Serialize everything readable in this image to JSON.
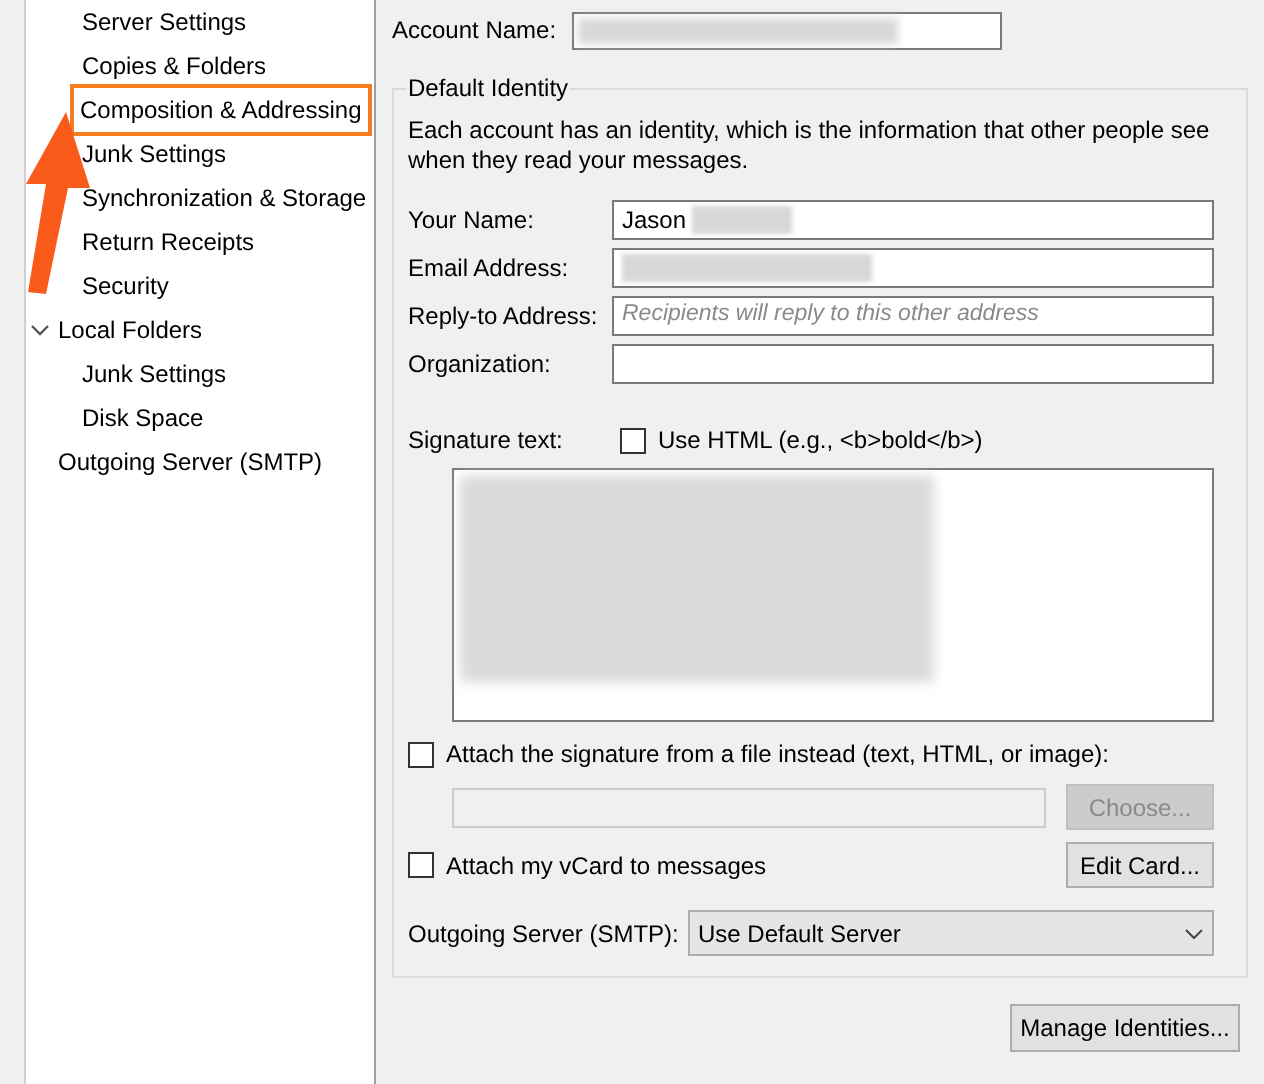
{
  "sidebar": {
    "account_pages": [
      {
        "label": "Server Settings",
        "selected": false
      },
      {
        "label": "Copies & Folders",
        "selected": false
      },
      {
        "label": "Composition & Addressing",
        "selected": true
      },
      {
        "label": "Junk Settings",
        "selected": false
      },
      {
        "label": "Synchronization & Storage",
        "selected": false
      },
      {
        "label": "Return Receipts",
        "selected": false
      },
      {
        "label": "Security",
        "selected": false
      }
    ],
    "items": [
      {
        "label": "Local Folders",
        "selected": false,
        "expanded": true,
        "children": [
          {
            "label": "Junk Settings",
            "selected": false
          },
          {
            "label": "Disk Space",
            "selected": false
          }
        ]
      },
      {
        "label": "Outgoing Server (SMTP)",
        "selected": false
      }
    ]
  },
  "account_name": {
    "label": "Account Name:"
  },
  "default_identity": {
    "title": "Default Identity",
    "description": "Each account has an identity, which is the information that other people see when they read your messages.",
    "fields": [
      {
        "label": "Your Name:",
        "value": "Jason",
        "redacted": true
      },
      {
        "label": "Email Address:",
        "redacted": true
      },
      {
        "label": "Reply-to Address:",
        "placeholder": "Recipients will reply to this other address"
      },
      {
        "label": "Organization:"
      }
    ],
    "signature": {
      "label": "Signature text:",
      "use_html": {
        "label": "Use HTML (e.g., <b>bold</b>)",
        "checked": false
      }
    },
    "attach_file": {
      "label": "Attach the signature from a file instead (text, HTML, or image):",
      "checked": false
    },
    "choose_button": {
      "label": "Choose...",
      "disabled": true
    },
    "attach_vcard": {
      "label": "Attach my vCard to messages",
      "checked": false
    },
    "edit_card_button": {
      "label": "Edit Card..."
    },
    "outgoing_server": {
      "label": "Outgoing Server (SMTP):",
      "value": "Use Default Server"
    }
  },
  "manage_identities_button": {
    "label": "Manage Identities..."
  }
}
